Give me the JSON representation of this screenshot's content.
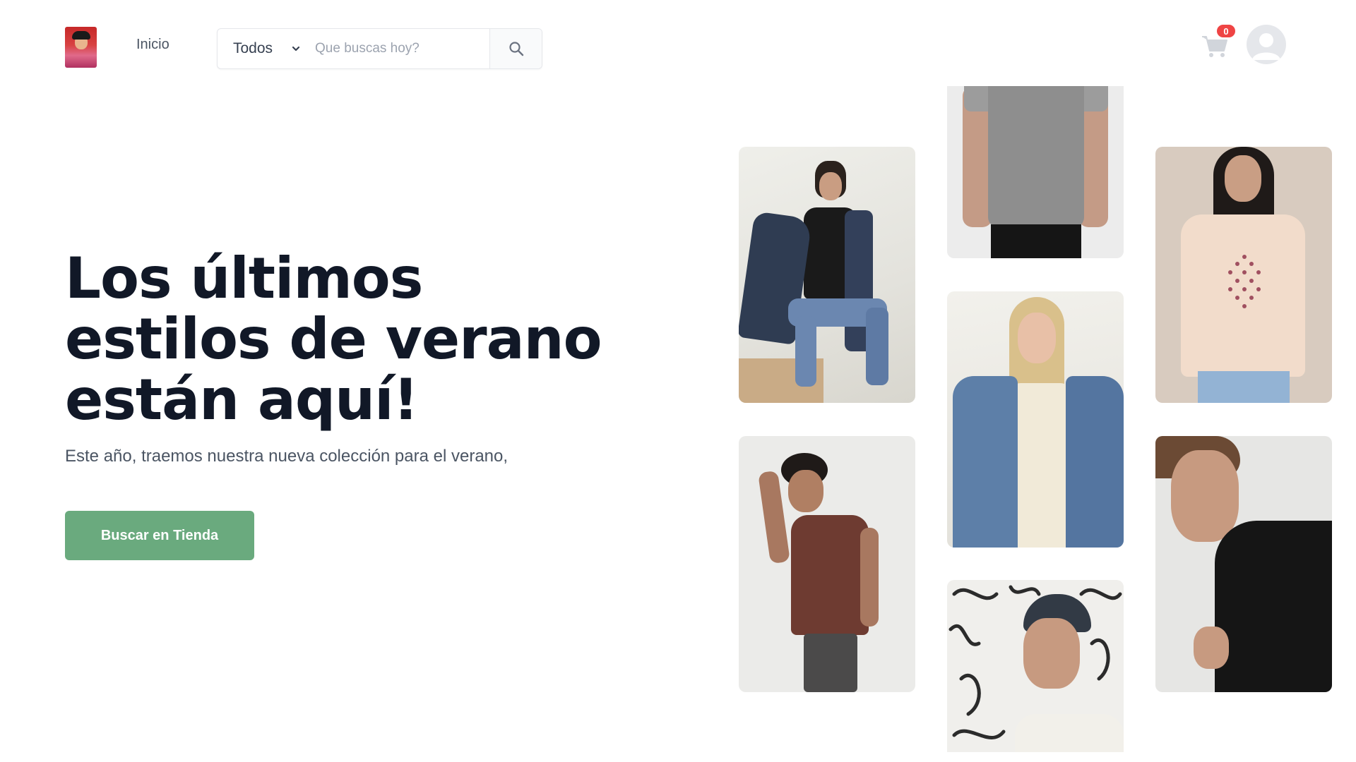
{
  "header": {
    "logo_alt": "logo",
    "nav_home": "Inicio",
    "search": {
      "category_selected": "Todos",
      "placeholder": "Que buscas hoy?"
    },
    "cart_count": "0",
    "icons": {
      "chevron": "chevron-down-icon",
      "search": "search-icon",
      "cart": "cart-icon",
      "avatar": "user-avatar-icon"
    }
  },
  "hero": {
    "title": "Los últimos estilos de verano están aquí!",
    "subtitle": "Este año, traemos nuestra nueva colección para el verano,",
    "cta_label": "Buscar en Tienda"
  },
  "colors": {
    "cta": "#6aaa7e",
    "badge": "#ef4444",
    "title": "#111827"
  }
}
